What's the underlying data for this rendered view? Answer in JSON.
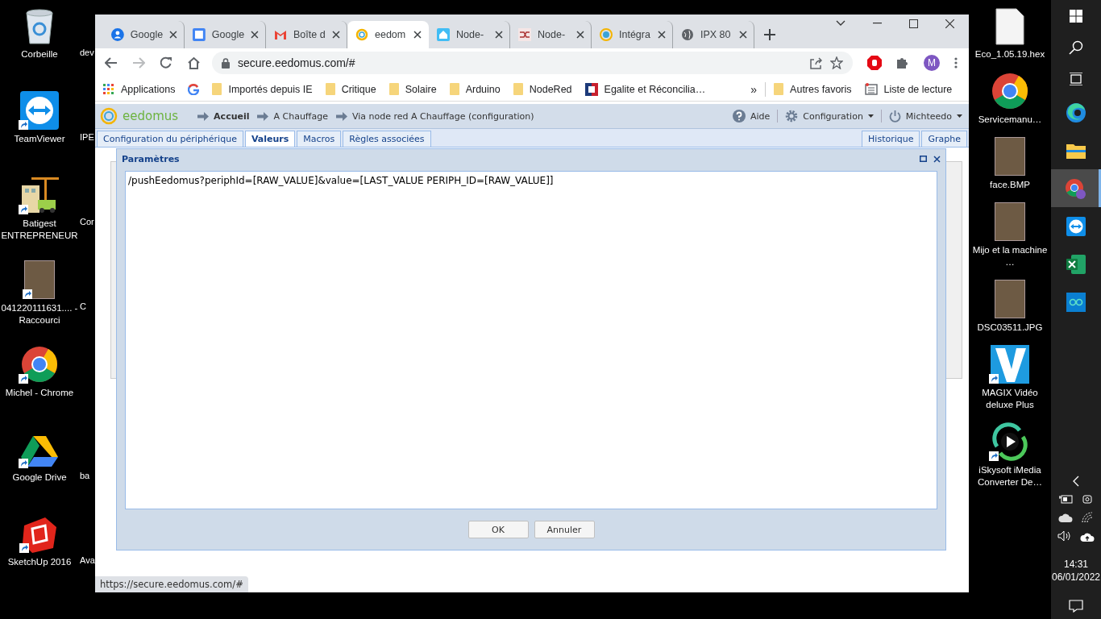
{
  "desktop_left": [
    {
      "label": "Corbeille",
      "kind": "recycle",
      "shortcut": false,
      "covered_label": "dev"
    },
    {
      "label": "TeamViewer",
      "kind": "teamviewer",
      "shortcut": true,
      "covered_label": "IPE"
    },
    {
      "label": "Batigest ENTREPRENEUR",
      "kind": "building",
      "shortcut": true,
      "covered_label": "Cor"
    },
    {
      "label": "041220111631.... - Raccourci",
      "kind": "photo",
      "shortcut": true,
      "covered_label": "C"
    },
    {
      "label": "Michel - Chrome",
      "kind": "chrome",
      "shortcut": true
    },
    {
      "label": "Google Drive",
      "kind": "drive",
      "shortcut": true,
      "covered_label": "ba"
    },
    {
      "label": "SketchUp 2016",
      "kind": "sketchup",
      "shortcut": true,
      "covered_label": "Ava"
    }
  ],
  "browser": {
    "tabs": [
      {
        "title": "Google",
        "selected": false
      },
      {
        "title": "Google",
        "selected": false
      },
      {
        "title": "Boîte d",
        "selected": false
      },
      {
        "title": "eedom",
        "selected": true
      },
      {
        "title": "Node-",
        "selected": false
      },
      {
        "title": "Node-",
        "selected": false
      },
      {
        "title": "Intégra",
        "selected": false
      },
      {
        "title": "IPX 80",
        "selected": false
      }
    ],
    "address": "secure.eedomus.com/#",
    "profile_letter": "M",
    "bookmarks": [
      "Applications",
      "Importés depuis IE",
      "Critique",
      "Solaire",
      "Arduino",
      "NodeRed",
      "Egalite et Réconcilia…"
    ],
    "bookmarks_more": "»",
    "bookmarks_right": [
      "Autres favoris",
      "Liste de lecture"
    ],
    "status_url": "https://secure.eedomus.com/#"
  },
  "eedomus": {
    "logo": "eedomus",
    "breadcrumbs": [
      {
        "label": "Accueil",
        "bold": true
      },
      {
        "label": "A Chauffage",
        "bold": false
      },
      {
        "label": "Via node red A Chauffage (configuration)",
        "bold": false
      }
    ],
    "help": "Aide",
    "config": "Configuration",
    "user": "Michteedo",
    "tabs": [
      {
        "label": "Configuration du périphérique",
        "selected": false
      },
      {
        "label": "Valeurs",
        "selected": true
      },
      {
        "label": "Macros",
        "selected": false
      },
      {
        "label": "Règles associées",
        "selected": false
      }
    ],
    "tabs_right": [
      {
        "label": "Historique",
        "selected": false
      },
      {
        "label": "Graphe",
        "selected": false
      }
    ],
    "dialog": {
      "title": "Paramètres",
      "value": "/pushEedomus?periphId=[RAW_VALUE]&value=[LAST_VALUE PERIPH_ID=[RAW_VALUE]]",
      "buttons": [
        "OK",
        "Annuler"
      ]
    }
  },
  "desktop_right": [
    {
      "label": "Eco_1.05.19.hex",
      "kind": "file",
      "shortcut": false
    },
    {
      "label": "Servicemanu…",
      "kind": "chrome",
      "shortcut": false
    },
    {
      "label": "face.BMP",
      "kind": "photo",
      "shortcut": false
    },
    {
      "label": "Mijo et la machine …",
      "kind": "photo",
      "shortcut": false
    },
    {
      "label": "DSC03511.JPG",
      "kind": "photo",
      "shortcut": false
    },
    {
      "label": "MAGIX Vidéo deluxe Plus",
      "kind": "magix",
      "shortcut": true
    },
    {
      "label": "iSkysoft iMedia Converter De…",
      "kind": "iskysoft",
      "shortcut": true
    }
  ],
  "taskbar": {
    "apps": [
      {
        "kind": "edge",
        "selected": false
      },
      {
        "kind": "folder",
        "selected": false
      },
      {
        "kind": "chrome",
        "selected": true
      },
      {
        "kind": "teamviewer",
        "selected": false
      },
      {
        "kind": "excel",
        "selected": false
      },
      {
        "kind": "arduino",
        "selected": false
      }
    ],
    "time": "14:31",
    "date": "06/01/2022"
  }
}
